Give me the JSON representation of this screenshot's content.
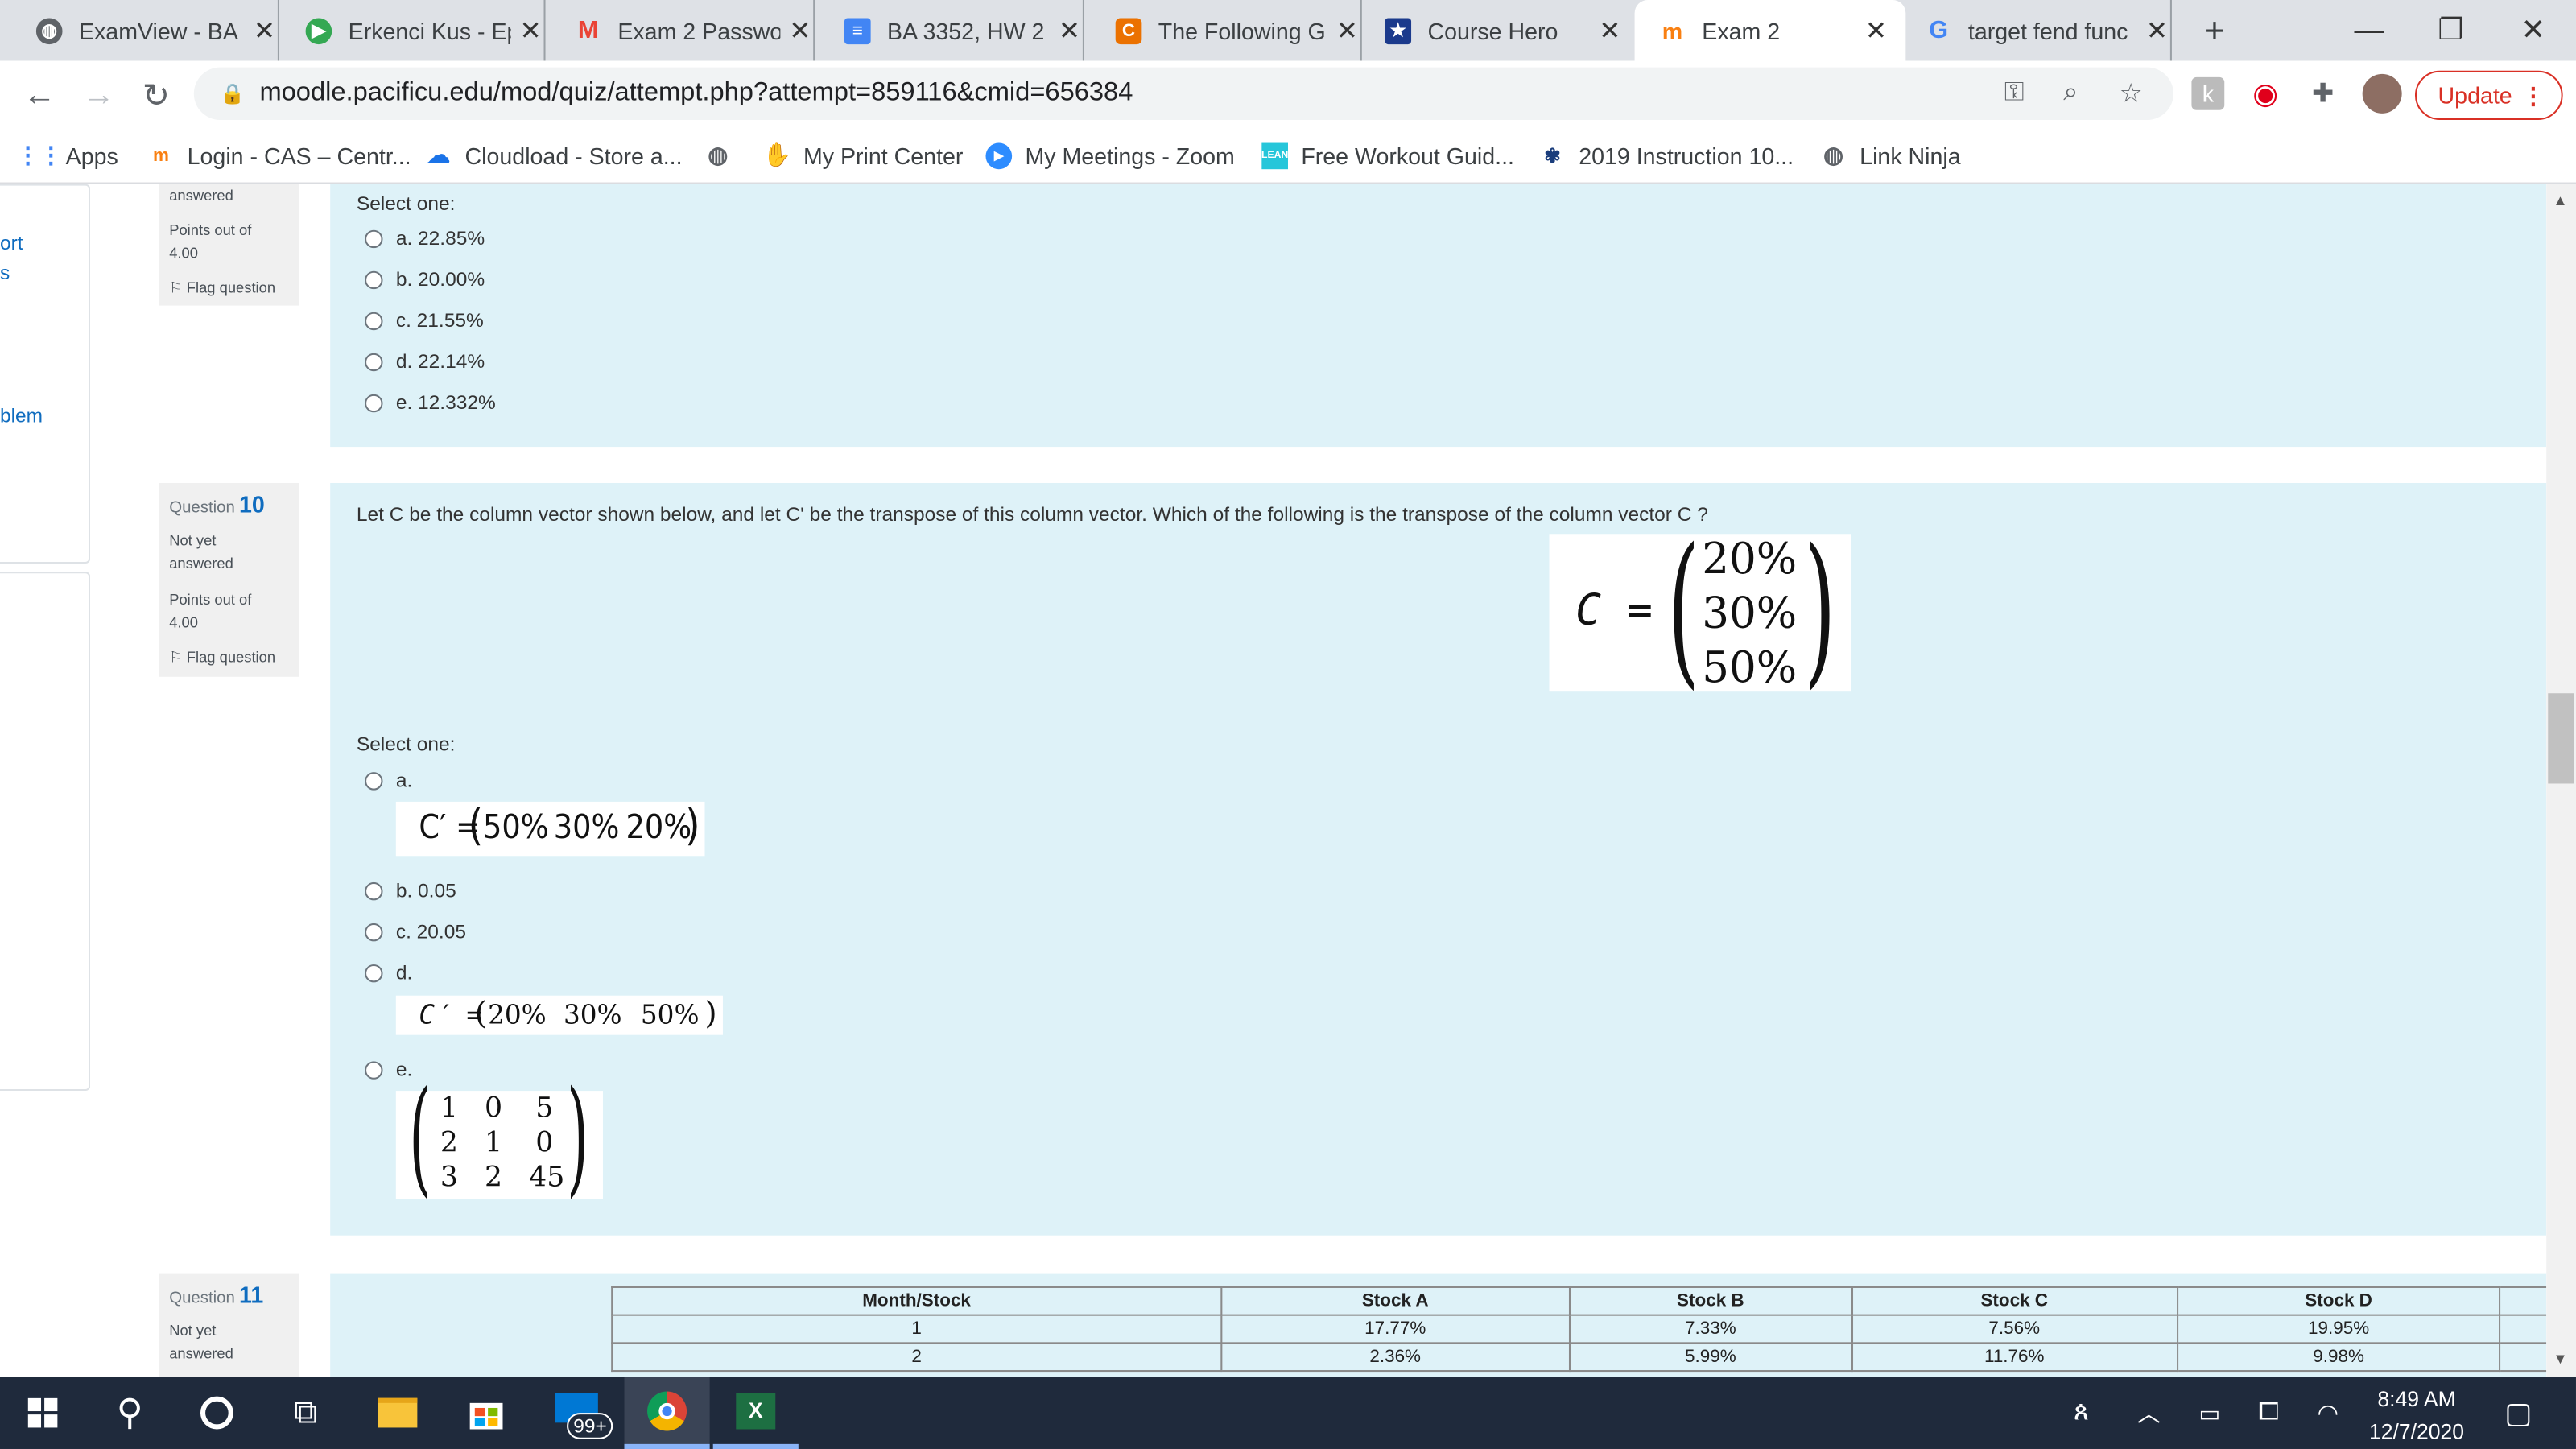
{
  "browser": {
    "tabs": [
      {
        "label": "ExamView - BA",
        "icon": "globe-icon",
        "active": false
      },
      {
        "label": "Erkenci Kus - Ep",
        "icon": "play-icon",
        "active": false
      },
      {
        "label": "Exam 2 Passwor",
        "icon": "gmail-icon",
        "active": false
      },
      {
        "label": "BA 3352, HW 2",
        "icon": "docs-icon",
        "active": false
      },
      {
        "label": "The Following G",
        "icon": "chegg-icon",
        "active": false
      },
      {
        "label": "Course Hero",
        "icon": "coursehero-icon",
        "active": false
      },
      {
        "label": "Exam 2",
        "icon": "moodle-icon",
        "active": true
      },
      {
        "label": "target fend func",
        "icon": "google-icon",
        "active": false
      }
    ],
    "new_tab_symbol": "+",
    "url": "moodle.pacificu.edu/mod/quiz/attempt.php?attempt=859116&cmid=656384",
    "update_label": "Update",
    "bookmarks": [
      {
        "label": "Apps",
        "icon": "apps-grid-icon"
      },
      {
        "label": "Login - CAS – Centr...",
        "icon": "moodle-icon"
      },
      {
        "label": "Cloudload - Store a...",
        "icon": "cloud-icon"
      },
      {
        "label": "",
        "icon": "globe-icon"
      },
      {
        "label": "My Print Center",
        "icon": "hand-icon"
      },
      {
        "label": "My Meetings - Zoom",
        "icon": "zoom-icon"
      },
      {
        "label": "Free Workout Guid...",
        "icon": "lean-icon"
      },
      {
        "label": "2019 Instruction 10...",
        "icon": "irs-icon"
      },
      {
        "label": "Link Ninja",
        "icon": "globe-icon"
      }
    ]
  },
  "sidebar_fragments": [
    "ort",
    "s",
    "blem"
  ],
  "q9": {
    "status_tail": "answered",
    "points_label": "Points out of",
    "points_value": "4.00",
    "flag_label": "Flag question",
    "select_one": "Select one:",
    "options": [
      "a. 22.85%",
      "b. 20.00%",
      "c. 21.55%",
      "d. 22.14%",
      "e. 12.332%"
    ]
  },
  "q10": {
    "question_label": "Question",
    "number": "10",
    "status_line1": "Not yet",
    "status_line2": "answered",
    "points_label": "Points out of",
    "points_value": "4.00",
    "flag_label": "Flag question",
    "text": "Let C be the column vector shown below, and let C' be the transpose of this column vector.  Which of the following is the transpose of the column vector C ?",
    "vector_lhs": "C =",
    "vector_values": [
      "20%",
      "30%",
      "50%"
    ],
    "select_one": "Select one:",
    "opt_a": "a.",
    "opt_a_math": {
      "lhs": "C′ =",
      "values": [
        "50%",
        "30%",
        "20%"
      ]
    },
    "opt_b": "b. 0.05",
    "opt_c": "c. 20.05",
    "opt_d": "d.",
    "opt_d_math": {
      "lhs": "C′ =",
      "values": [
        "20%",
        "30%",
        "50%"
      ]
    },
    "opt_e": "e.",
    "opt_e_matrix": [
      [
        "1",
        "0",
        "5"
      ],
      [
        "2",
        "1",
        "0"
      ],
      [
        "3",
        "2",
        "45"
      ]
    ]
  },
  "q11": {
    "question_label": "Question",
    "number": "11",
    "status_line1": "Not yet",
    "status_line2": "answered",
    "table_headers": [
      "Month/Stock",
      "Stock A",
      "Stock B",
      "Stock C",
      "Stock D"
    ],
    "table_rows": [
      [
        "1",
        "17.77%",
        "7.33%",
        "7.56%",
        "19.95%"
      ],
      [
        "2",
        "2.36%",
        "5.99%",
        "11.76%",
        "9.98%"
      ]
    ]
  },
  "taskbar": {
    "mail_badge": "99+",
    "time": "8:49 AM",
    "date": "12/7/2020"
  },
  "colors": {
    "question_bg": "#def2f8",
    "info_bg": "#f0f0f0",
    "moodle_blue": "#0f6cbf",
    "update_red": "#d93025",
    "taskbar": "#1f2a3c"
  }
}
